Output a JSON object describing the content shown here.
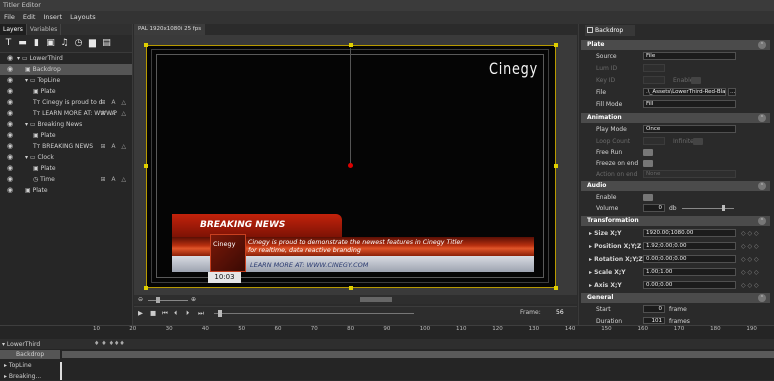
{
  "window": {
    "title": "Titler Editor"
  },
  "menu": [
    "File",
    "Edit",
    "Insert",
    "Layouts"
  ],
  "left_panel": {
    "tabs": [
      "Layers",
      "Variables"
    ],
    "toolbar_icons": [
      "text-icon",
      "minus-box-icon",
      "mobile-icon",
      "image-icon",
      "music-icon",
      "clock-icon",
      "folder-icon",
      "film-icon"
    ],
    "layers": [
      {
        "label": "LowerThird",
        "indent": 0,
        "type": "group"
      },
      {
        "label": "Backdrop",
        "indent": 1,
        "type": "image",
        "selected": true
      },
      {
        "label": "TopLine",
        "indent": 1,
        "type": "group"
      },
      {
        "label": "Plate",
        "indent": 2,
        "type": "image"
      },
      {
        "label": "Cinegy is proud to d",
        "indent": 2,
        "type": "text",
        "controls": "⊞ A △"
      },
      {
        "label": "LEARN MORE AT: WWW.P",
        "indent": 2,
        "type": "text",
        "controls": "⊞ A △"
      },
      {
        "label": "Breaking News",
        "indent": 1,
        "type": "group"
      },
      {
        "label": "Plate",
        "indent": 2,
        "type": "image"
      },
      {
        "label": "BREAKING NEWS",
        "indent": 2,
        "type": "text",
        "controls": "⊞ A △"
      },
      {
        "label": "Clock",
        "indent": 1,
        "type": "group"
      },
      {
        "label": "Plate",
        "indent": 2,
        "type": "image"
      },
      {
        "label": "Time",
        "indent": 2,
        "type": "clock",
        "controls": "⊞ A △"
      },
      {
        "label": "Plate",
        "indent": 1,
        "type": "image"
      }
    ]
  },
  "document_tab": "PAL 1920x1080i 25 fps",
  "canvas": {
    "logo": "Cinegy",
    "breaking_news": "BREAKING NEWS",
    "news_line1": "Cinegy is proud to demonstrate the newest features in Cinegy Titler",
    "news_line2": "for realtime, data reactive branding",
    "learn_more": "LEARN MORE AT: WWW.CINEGY.COM",
    "cube_logo": "Cinegy",
    "clock": "10:03"
  },
  "transport": {
    "frame_label": "Frame:",
    "frame_value": "56"
  },
  "right_panel": {
    "tab": "Backdrop",
    "sections": {
      "plate": "Plate",
      "animation": "Animation",
      "audio": "Audio",
      "transformation": "Transformation",
      "general": "General"
    },
    "plate": {
      "source_label": "Source",
      "source_value": "File",
      "luma_label": "Lum ID",
      "key_label": "Key ID",
      "enable_label": "Enable",
      "file_label": "File",
      "file_value": ".\\_Assets\\LowerThird-Red-Blank",
      "fill_label": "Fill Mode",
      "fill_value": "Fill"
    },
    "animation": {
      "playmode_label": "Play Mode",
      "playmode_value": "Once",
      "loop_label": "Loop Count",
      "infinite_label": "Infinite",
      "freerun_label": "Free Run",
      "freeze_label": "Freeze on end",
      "action_label": "Action on end",
      "action_value": "None"
    },
    "audio": {
      "enable_label": "Enable",
      "volume_label": "Volume",
      "volume_value": "0",
      "volume_unit": "db"
    },
    "transformation": {
      "size_label": "Size X;Y",
      "size_value": "1920.00;1080.00",
      "position_label": "Position X;Y;Z",
      "position_value": "1.92;0.00;0.00",
      "rotation_label": "Rotation X;Y;Z",
      "rotation_value": "0.00;0.00;0.00",
      "scale_label": "Scale X;Y",
      "scale_value": "1.00;1.00",
      "axis_label": "Axis X;Y",
      "axis_value": "0.00;0.00"
    },
    "general": {
      "start_label": "Start",
      "start_value": "0",
      "start_unit": "frame",
      "duration_label": "Duration",
      "duration_value": "101",
      "duration_unit": "frames"
    }
  },
  "timeline": {
    "ticks": [
      "10",
      "20",
      "30",
      "40",
      "50",
      "60",
      "70",
      "80",
      "90",
      "100",
      "110",
      "120",
      "130",
      "140",
      "150",
      "160",
      "170",
      "180",
      "190"
    ],
    "rows": [
      {
        "label": "LowerThird",
        "marks": "♦  ♦  ♦♦♦"
      },
      {
        "label": "Backdrop",
        "selected": true
      },
      {
        "label": "TopLine"
      },
      {
        "label": "Breaking..."
      }
    ]
  }
}
